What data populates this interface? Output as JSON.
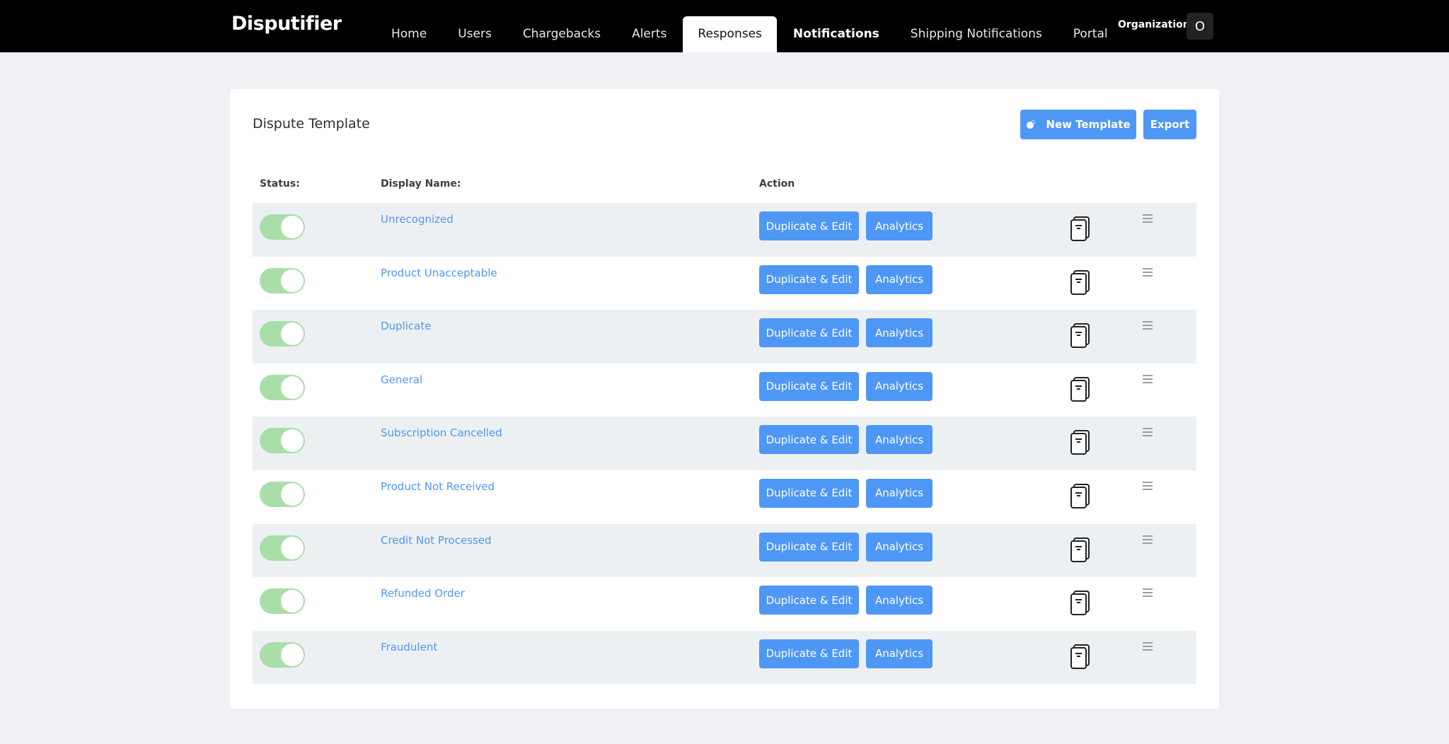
{
  "app": {
    "logo": "Disputifier"
  },
  "nav": {
    "items": [
      {
        "label": "Home"
      },
      {
        "label": "Users"
      },
      {
        "label": "Chargebacks"
      },
      {
        "label": "Alerts"
      },
      {
        "label": "Responses"
      },
      {
        "label": "Notifications"
      },
      {
        "label": "Shipping Notifications"
      },
      {
        "label": "Portal"
      }
    ],
    "active": "Responses"
  },
  "org": {
    "label": "Organization",
    "avatar": "O"
  },
  "page": {
    "title": "Dispute Template",
    "new_template_label": "New Template",
    "export_label": "Export"
  },
  "table": {
    "headers": {
      "status": "Status:",
      "display_name": "Display Name:",
      "action": "Action"
    },
    "duplicate_label": "Duplicate & Edit",
    "analytics_label": "Analytics",
    "rows": [
      {
        "name": "Unrecognized",
        "enabled": true
      },
      {
        "name": "Product Unacceptable",
        "enabled": true
      },
      {
        "name": "Duplicate",
        "enabled": true
      },
      {
        "name": "General",
        "enabled": true
      },
      {
        "name": "Subscription Cancelled",
        "enabled": true
      },
      {
        "name": "Product Not Received",
        "enabled": true
      },
      {
        "name": "Credit Not Processed",
        "enabled": true
      },
      {
        "name": "Refunded Order",
        "enabled": true
      },
      {
        "name": "Fraudulent",
        "enabled": true
      }
    ]
  },
  "colors": {
    "accent": "#4f97f5",
    "toggle_on": "#a9dea9",
    "topbar": "#000000",
    "row_shade": "#edf0f3"
  },
  "icons": {
    "row_doc": "document-stack-icon",
    "row_drag": "drag-handle-icon",
    "new_template": "toggle-dot-icon"
  }
}
